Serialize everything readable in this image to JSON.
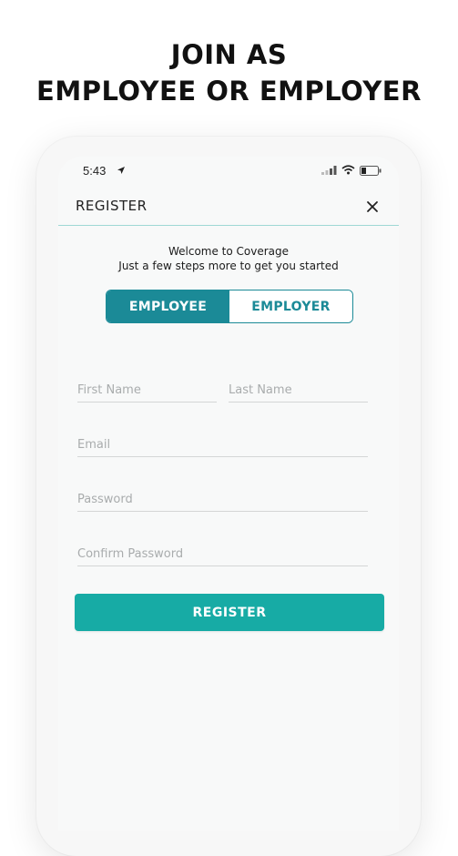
{
  "promo": {
    "line1": "JOIN AS",
    "line2": "EMPLOYEE OR EMPLOYER"
  },
  "status_bar": {
    "time": "5:43"
  },
  "app_bar": {
    "title": "REGISTER",
    "close_icon": "close-icon"
  },
  "welcome": {
    "line1": "Welcome to Coverage",
    "line2": "Just a few steps more to get you started"
  },
  "role_toggle": {
    "options": [
      "EMPLOYEE",
      "EMPLOYER"
    ],
    "selected": "EMPLOYEE"
  },
  "form": {
    "first_name_placeholder": "First Name",
    "last_name_placeholder": "Last Name",
    "email_placeholder": "Email",
    "password_placeholder": "Password",
    "confirm_password_placeholder": "Confirm Password"
  },
  "register_button": {
    "label": "REGISTER"
  },
  "colors": {
    "accent_dark": "#1b8a97",
    "accent_button": "#17aba5",
    "divider": "#9ed8d5"
  }
}
